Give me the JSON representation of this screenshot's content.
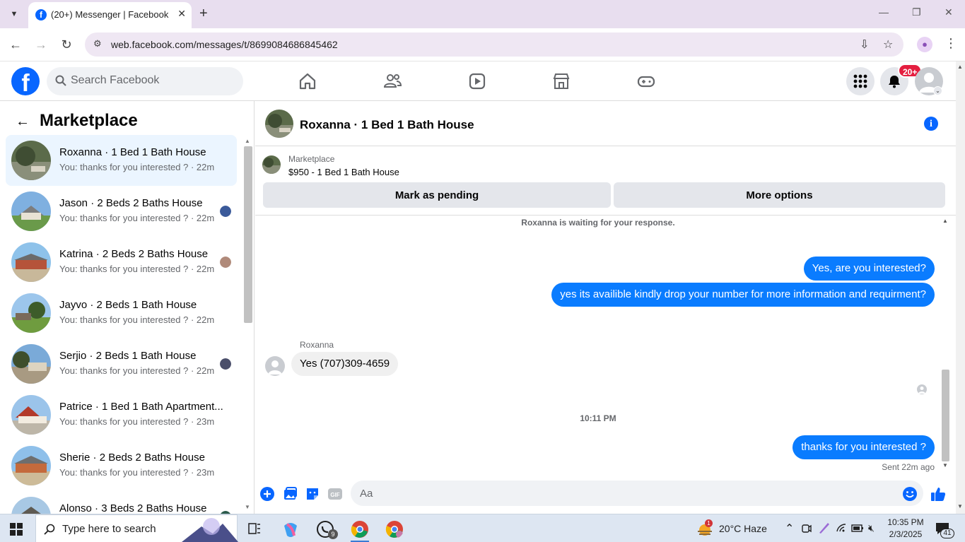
{
  "browser": {
    "tab_title": "(20+) Messenger | Facebook",
    "url": "web.facebook.com/messages/t/8699084686845462"
  },
  "header": {
    "search_placeholder": "Search Facebook",
    "notification_badge": "20+"
  },
  "sidebar": {
    "title": "Marketplace",
    "conversations": [
      {
        "name": "Roxanna · 1 Bed 1 Bath House",
        "preview": "You: thanks for you interested ? · 22m",
        "active": true
      },
      {
        "name": "Jason · 2 Beds 2 Baths House",
        "preview": "You: thanks for you interested ? · 22m",
        "active": false
      },
      {
        "name": "Katrina · 2 Beds 2 Baths House",
        "preview": "You: thanks for you interested ? · 22m",
        "active": false
      },
      {
        "name": "Jayvo · 2 Beds 1 Bath House",
        "preview": "You: thanks for you interested ? · 22m",
        "active": false
      },
      {
        "name": "Serjio · 2 Beds 1 Bath House",
        "preview": "You: thanks for you interested ? · 22m",
        "active": false
      },
      {
        "name": "Patrice · 1 Bed 1 Bath Apartment...",
        "preview": "You: thanks for you interested ? · 23m",
        "active": false
      },
      {
        "name": "Sherie · 2 Beds 2 Baths House",
        "preview": "You: thanks for you interested ? · 23m",
        "active": false
      },
      {
        "name": "Alonso · 3 Beds 2 Baths House",
        "preview": "",
        "active": false
      }
    ]
  },
  "chat": {
    "title": "Roxanna · 1 Bed 1 Bath House",
    "listing_label": "Marketplace",
    "listing_price": "$950 - 1 Bed 1 Bath House",
    "mark_pending_label": "Mark as pending",
    "more_options_label": "More options",
    "waiting_notice": "Roxanna is waiting for your response.",
    "out_msg_1": "Yes, are you interested?",
    "out_msg_2": "yes its availible kindly drop your number for more information and requirment?",
    "sender_name": "Roxanna",
    "in_msg_1": "Yes (707)309-4659",
    "timestamp": "10:11 PM",
    "out_msg_3": "thanks for you interested ?",
    "sent_status": "Sent 22m ago",
    "composer_placeholder": "Aa"
  },
  "taskbar": {
    "search_placeholder": "Type here to search",
    "whatsapp_badge": "9",
    "weather": "20°C  Haze",
    "weather_alert": "1",
    "time": "10:35 PM",
    "date": "2/3/2025",
    "notification_count": "41"
  },
  "colors": {
    "fb_blue": "#0866ff",
    "bubble_blue": "#0a7cff",
    "active_row": "#ebf5ff",
    "badge_red": "#e41e3f"
  }
}
